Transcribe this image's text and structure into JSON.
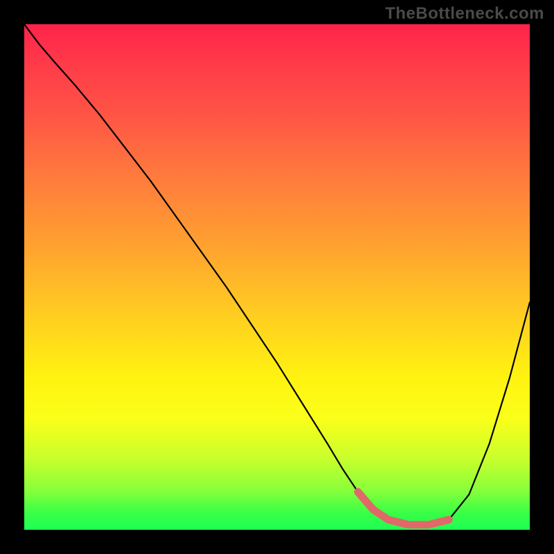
{
  "watermark": "TheBottleneck.com",
  "colors": {
    "background": "#000000",
    "curve": "#000000",
    "highlight": "#e06868",
    "gradient_top": "#ff234a",
    "gradient_bottom": "#1fff55"
  },
  "chart_data": {
    "type": "line",
    "title": "",
    "xlabel": "",
    "ylabel": "",
    "xlim": [
      0,
      100
    ],
    "ylim": [
      0,
      100
    ],
    "grid": false,
    "series": [
      {
        "name": "bottleneck-curve",
        "x": [
          0,
          3,
          6,
          10,
          15,
          20,
          25,
          30,
          35,
          40,
          45,
          50,
          55,
          60,
          63,
          66,
          69,
          72,
          76,
          80,
          84,
          88,
          92,
          96,
          100
        ],
        "y": [
          100,
          96,
          92.5,
          88,
          82,
          75.5,
          69,
          62,
          55,
          48,
          40.5,
          33,
          25,
          17,
          12,
          7.5,
          4,
          2,
          1,
          1,
          2,
          7,
          17,
          30,
          45
        ]
      }
    ],
    "highlight_region": {
      "name": "minimum-plateau",
      "x": [
        66,
        69,
        72,
        76,
        80,
        84
      ],
      "y": [
        7.5,
        4,
        2,
        1,
        1,
        2
      ]
    }
  }
}
